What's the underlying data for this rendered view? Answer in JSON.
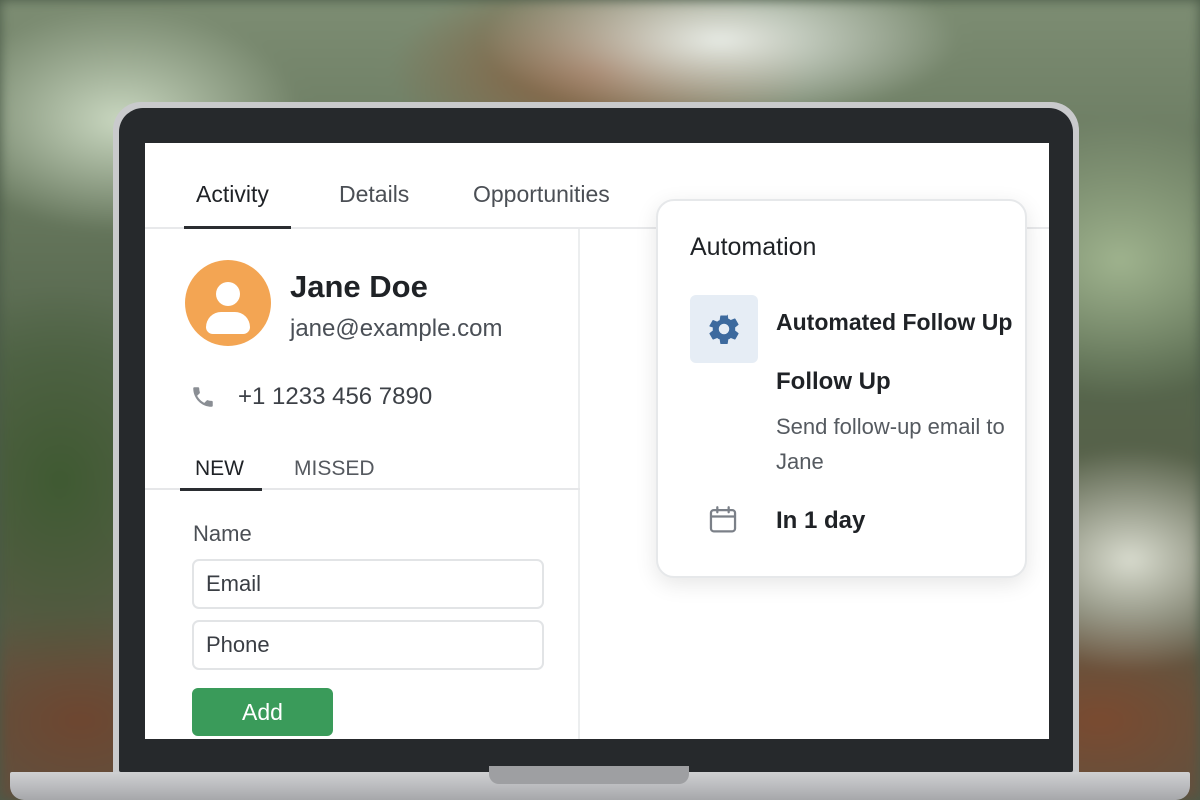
{
  "tabs": [
    {
      "label": "Activity",
      "active": true
    },
    {
      "label": "Details",
      "active": false
    },
    {
      "label": "Opportunities",
      "active": false
    }
  ],
  "contact": {
    "name": "Jane Doe",
    "email": "jane@example.com",
    "phone": "+1 1233 456 7890",
    "avatar_icon": "user-avatar-icon",
    "phone_icon": "phone-icon",
    "avatar_color": "#f3a553"
  },
  "sub_tabs": [
    {
      "label": "NEW",
      "active": true
    },
    {
      "label": "MISSED",
      "active": false
    }
  ],
  "form": {
    "name_label": "Name",
    "email_placeholder": "Email",
    "phone_placeholder": "Phone",
    "add_label": "Add",
    "add_color": "#3a9b5a"
  },
  "automation": {
    "title": "Automation",
    "name": "Automated Follow Up",
    "icon": "gear-icon",
    "step_title": "Follow Up",
    "step_description": "Send follow-up email to Jane",
    "schedule_icon": "calendar-icon",
    "schedule": "In 1 day",
    "accent": "#3d6a9e"
  }
}
